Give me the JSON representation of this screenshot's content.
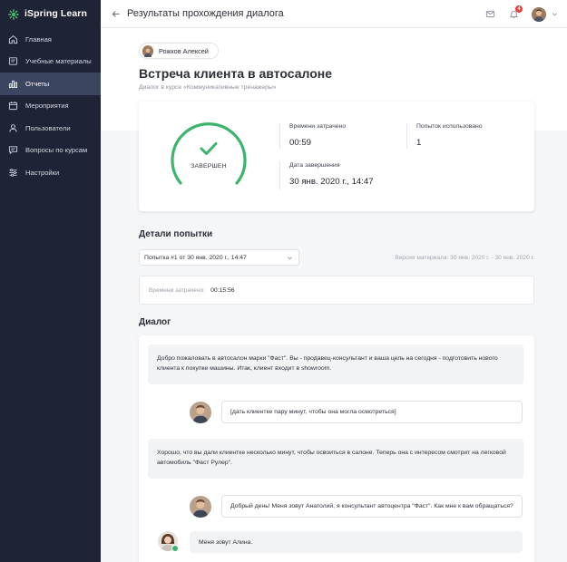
{
  "brand": {
    "name": "iSpring Learn"
  },
  "sidebar": {
    "items": [
      {
        "label": "Главная",
        "icon": "home-icon",
        "active": false
      },
      {
        "label": "Учебные материалы",
        "icon": "book-icon",
        "active": false
      },
      {
        "label": "Отчеты",
        "icon": "chart-icon",
        "active": true
      },
      {
        "label": "Мероприятия",
        "icon": "calendar-icon",
        "active": false
      },
      {
        "label": "Пользователи",
        "icon": "users-icon",
        "active": false
      },
      {
        "label": "Вопросы по курсам",
        "icon": "chat-icon",
        "active": false
      },
      {
        "label": "Настройки",
        "icon": "sliders-icon",
        "active": false
      }
    ]
  },
  "header": {
    "title": "Результаты прохождения диалога",
    "notifications_count": "4"
  },
  "user": {
    "name": "Рожков Алексей"
  },
  "dialog": {
    "title": "Встреча клиента в автосалоне",
    "subtitle": "Диалог в курсе «Коммуникативные тренажеры»"
  },
  "stats": {
    "status": "ЗАВЕРШЕН",
    "time_spent_label": "Времени затрачено",
    "time_spent_value": "00:59",
    "attempts_label": "Попыток использовано",
    "attempts_value": "1",
    "finish_date_label": "Дата завершения",
    "finish_date_value": "30 янв. 2020 г., 14:47"
  },
  "attempt_details": {
    "title": "Детали попытки",
    "selected_attempt": "Попытка #1 от 30 янв. 2020 г., 14:47",
    "version_text": "Версия материала: 30 янв. 2020 г. - 30 янв. 2020 г.",
    "time_label": "Времени затрачено:",
    "time_value": "00:15:56"
  },
  "chat": {
    "title": "Диалог",
    "messages": [
      {
        "role": "system",
        "text": "Добро пожаловать в автосалон марки \"Фаст\". Вы - продавец-консультант и ваша цель на сегодня - подготовить нового клиента к покупке машины. Итак, клиент входит в showroom."
      },
      {
        "role": "user",
        "text": "[дать клиентке пару минут, чтобы она могла осмотреться]"
      },
      {
        "role": "system",
        "text": "Хорошо, что вы дали клиентке несколько минут, чтобы освоиться в салоне. Теперь она с интересом смотрит на легковой автомобиль \"Фаст Рулер\"."
      },
      {
        "role": "user",
        "text": "Добрый день! Меня зовут Анатолий, я консультант автоцентра \"Фаст\". Как мне к вам обращаться?"
      },
      {
        "role": "npc",
        "text": "Меня зовут Алина."
      }
    ]
  },
  "colors": {
    "sidebar_bg": "#1e2336",
    "sidebar_active": "#3b4560",
    "success": "#3bb56b",
    "badge": "#e4413a"
  }
}
